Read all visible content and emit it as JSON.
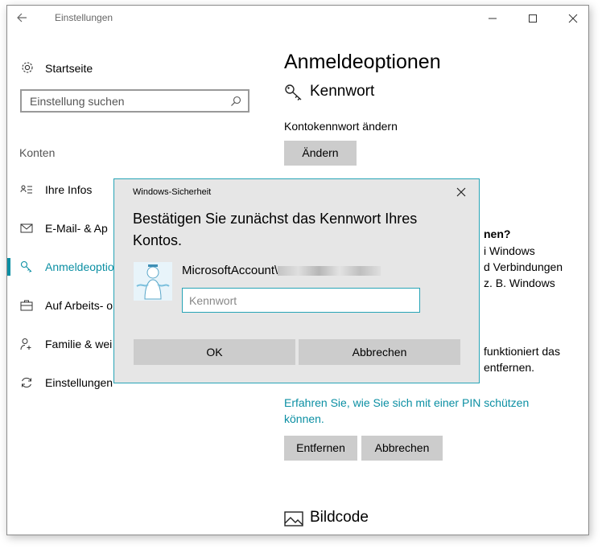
{
  "window": {
    "title": "Einstellungen"
  },
  "sidebar": {
    "home_label": "Startseite",
    "search_placeholder": "Einstellung suchen",
    "section_label": "Konten",
    "items": [
      {
        "label": "Ihre Infos",
        "icon": "person-card-icon"
      },
      {
        "label": "E-Mail- & Ap",
        "icon": "mail-icon"
      },
      {
        "label": "Anmeldeoptio",
        "icon": "key-icon",
        "active": true
      },
      {
        "label": "Auf Arbeits- o",
        "icon": "briefcase-icon"
      },
      {
        "label": "Familie & wei",
        "icon": "person-add-icon"
      },
      {
        "label": "Einstellungen",
        "icon": "sync-icon"
      }
    ]
  },
  "main": {
    "title": "Anmeldeoptionen",
    "password_section": {
      "heading": "Kennwort",
      "description": "Kontokennwort ändern",
      "change_button": "Ändern"
    },
    "partial_texts": [
      "nen?",
      "i Windows",
      "d Verbindungen",
      "z. B. Windows",
      "funktioniert das",
      "entfernen."
    ],
    "pin_link": "Erfahren Sie, wie Sie sich mit einer PIN schützen können.",
    "remove_button": "Entfernen",
    "cancel_button": "Abbrechen",
    "picture_section": {
      "heading": "Bildcode"
    }
  },
  "dialog": {
    "title": "Windows-Sicherheit",
    "heading": "Bestätigen Sie zunächst das Kennwort Ihres Kontos.",
    "account_prefix": "MicrosoftAccount\\",
    "password_placeholder": "Kennwort",
    "ok_button": "OK",
    "cancel_button": "Abbrechen"
  },
  "colors": {
    "accent": "#0b8fa3",
    "dialog_border": "#27a4b6",
    "button_bg": "#cccccc",
    "dialog_bg": "#e6e6e6"
  }
}
